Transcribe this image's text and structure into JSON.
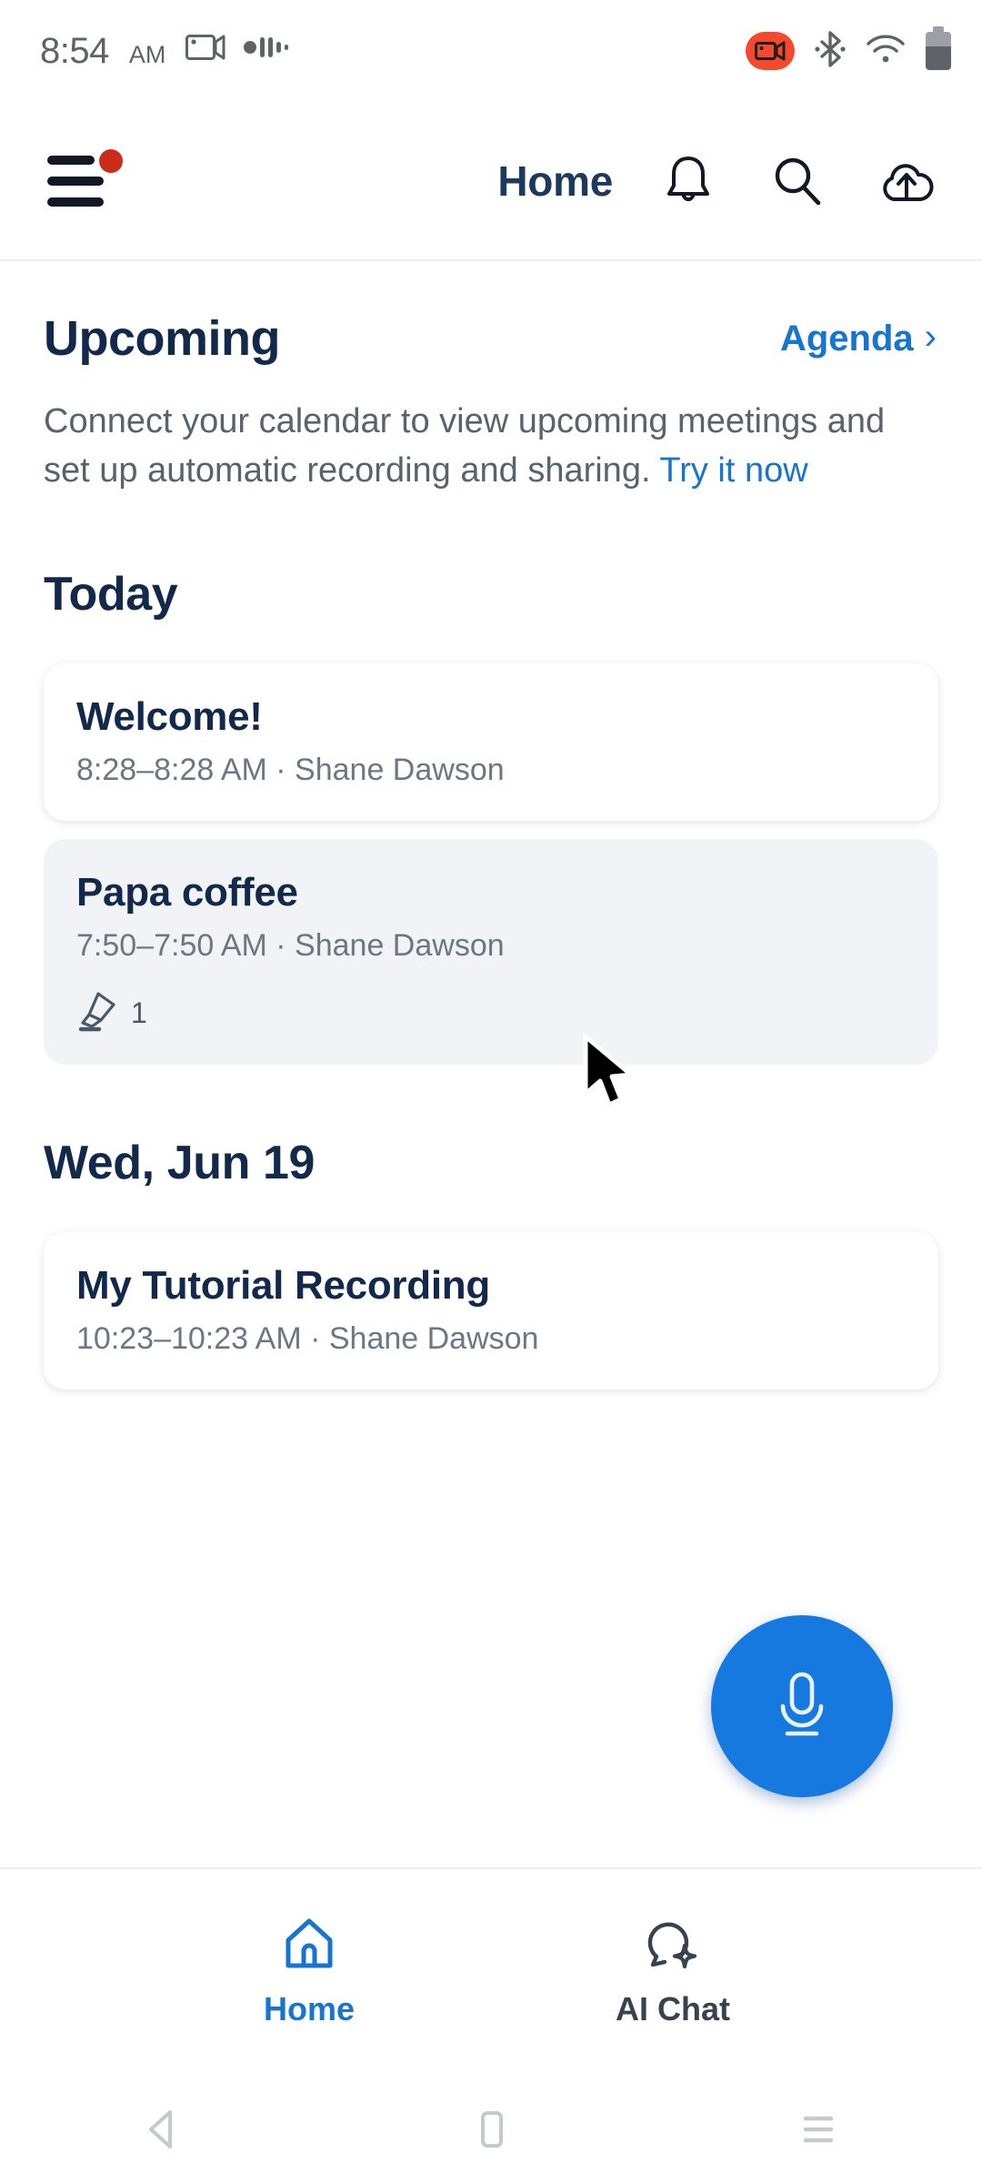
{
  "status_bar": {
    "time": "8:54",
    "ampm": "AM",
    "icons_left": [
      "screen-record-icon",
      "audio-waveform-icon"
    ],
    "icons_right": [
      "video-recording-badge-icon",
      "bluetooth-icon",
      "wifi-icon",
      "battery-icon"
    ],
    "recording_color": "#f4492d"
  },
  "header": {
    "menu_icon": "hamburger-menu-icon",
    "menu_badge": true,
    "title": "Home",
    "actions": [
      {
        "name": "notifications-icon",
        "label": "Notifications"
      },
      {
        "name": "search-icon",
        "label": "Search"
      },
      {
        "name": "cloud-upload-icon",
        "label": "Upload"
      }
    ],
    "title_color": "#1b3a5e"
  },
  "upcoming": {
    "title": "Upcoming",
    "agenda_label": "Agenda",
    "agenda_chevron": "›",
    "description_prefix": "Connect your calendar to view upcoming meetings and set up automatic recording and sharing. ",
    "try_label": "Try it now",
    "link_color": "#1775d1"
  },
  "sections": [
    {
      "day_label": "Today",
      "items": [
        {
          "title": "Welcome!",
          "subtitle": "8:28–8:28 AM ·  Shane Dawson",
          "selected": false,
          "meta": null
        },
        {
          "title": "Papa coffee",
          "subtitle": "7:50–7:50 AM ·  Shane Dawson",
          "selected": true,
          "meta": {
            "icon": "highlighter-icon",
            "count": "1"
          }
        }
      ]
    },
    {
      "day_label": "Wed, Jun 19",
      "items": [
        {
          "title": "My Tutorial Recording",
          "subtitle": "10:23–10:23 AM ·  Shane Dawson",
          "selected": false,
          "meta": null
        }
      ]
    }
  ],
  "fab": {
    "icon": "microphone-icon",
    "color": "#1579e0"
  },
  "bottom_nav": {
    "items": [
      {
        "label": "Home",
        "icon": "home-icon",
        "active": true
      },
      {
        "label": "AI Chat",
        "icon": "ai-chat-bubble-icon",
        "active": false
      }
    ],
    "active_color": "#1775d1",
    "idle_color": "#37424e"
  },
  "android_nav": {
    "back": "back-triangle-icon",
    "home": "home-square-icon",
    "recents": "recents-lines-icon"
  }
}
